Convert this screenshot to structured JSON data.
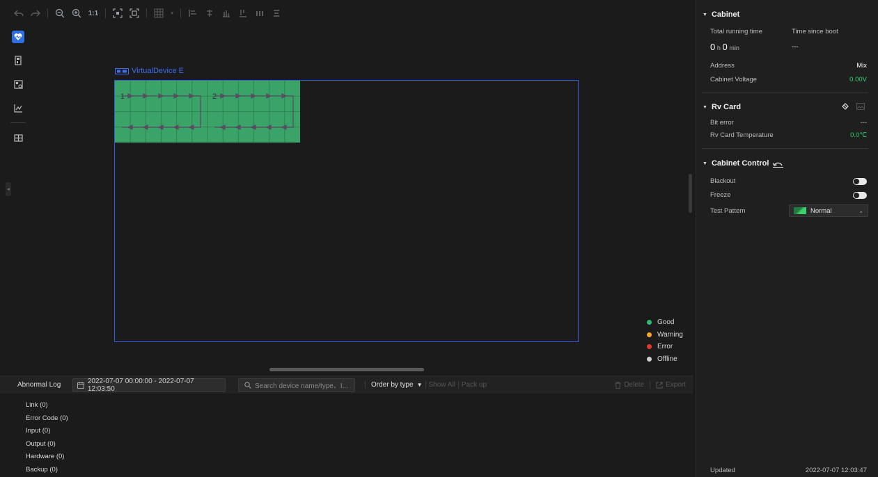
{
  "toolbar": {
    "icons": [
      "undo-icon",
      "redo-icon",
      "zoom-out-icon",
      "zoom-in-icon",
      "fit-icon",
      "center-icon",
      "grid-icon",
      "align-left-icon",
      "align-center-icon",
      "align-right-icon",
      "align-top-icon",
      "distribute-h-icon",
      "distribute-v-icon"
    ],
    "one_to_one": "1:1"
  },
  "rail": {
    "items": [
      "monitoring-icon",
      "receiving-card-icon",
      "cabinet-icon",
      "chart-icon",
      "cabinet-config-icon"
    ]
  },
  "canvas": {
    "device_title": "VirtualDevice E",
    "cabinet_color": "#3aa368",
    "frame_color": "#3457e6",
    "port_labels": [
      "1",
      "2"
    ]
  },
  "legend": [
    {
      "label": "Good",
      "color": "#2dbd6e"
    },
    {
      "label": "Warning",
      "color": "#f5a623"
    },
    {
      "label": "Error",
      "color": "#e53935"
    },
    {
      "label": "Offline",
      "color": "#d0d0d0"
    }
  ],
  "log": {
    "title": "Abnormal Log",
    "date_range": "2022-07-07 00:00:00  -  2022-07-07 12:03:50",
    "search_placeholder": "Search device name/type、I...",
    "order_label": "Order by type",
    "show_all": "Show All",
    "pack_up": "Pack up",
    "delete": "Delete",
    "export": "Export",
    "categories": [
      "Link (0)",
      "Error Code (0)",
      "Input (0)",
      "Output (0)",
      "Hardware (0)",
      "Backup (0)"
    ]
  },
  "panel": {
    "cabinet": {
      "title": "Cabinet",
      "total_running_label": "Total running time",
      "time_since_boot_label": "Time since boot",
      "running_h": "0",
      "h_unit": "h",
      "running_min": "0",
      "min_unit": "min",
      "boot_value": "---",
      "address_label": "Address",
      "address_value": "Mix",
      "voltage_label": "Cabinet Voltage",
      "voltage_value": "0.00V"
    },
    "rv_card": {
      "title": "Rv Card",
      "bit_error_label": "Bit error",
      "bit_error_value": "---",
      "temp_label": "Rv Card Temperature",
      "temp_value": "0.0℃"
    },
    "control": {
      "title": "Cabinet Control",
      "blackout_label": "Blackout",
      "freeze_label": "Freeze",
      "test_pattern_label": "Test Pattern",
      "test_pattern_value": "Normal"
    },
    "updated_label": "Updated",
    "updated_value": "2022-07-07 12:03:47"
  }
}
